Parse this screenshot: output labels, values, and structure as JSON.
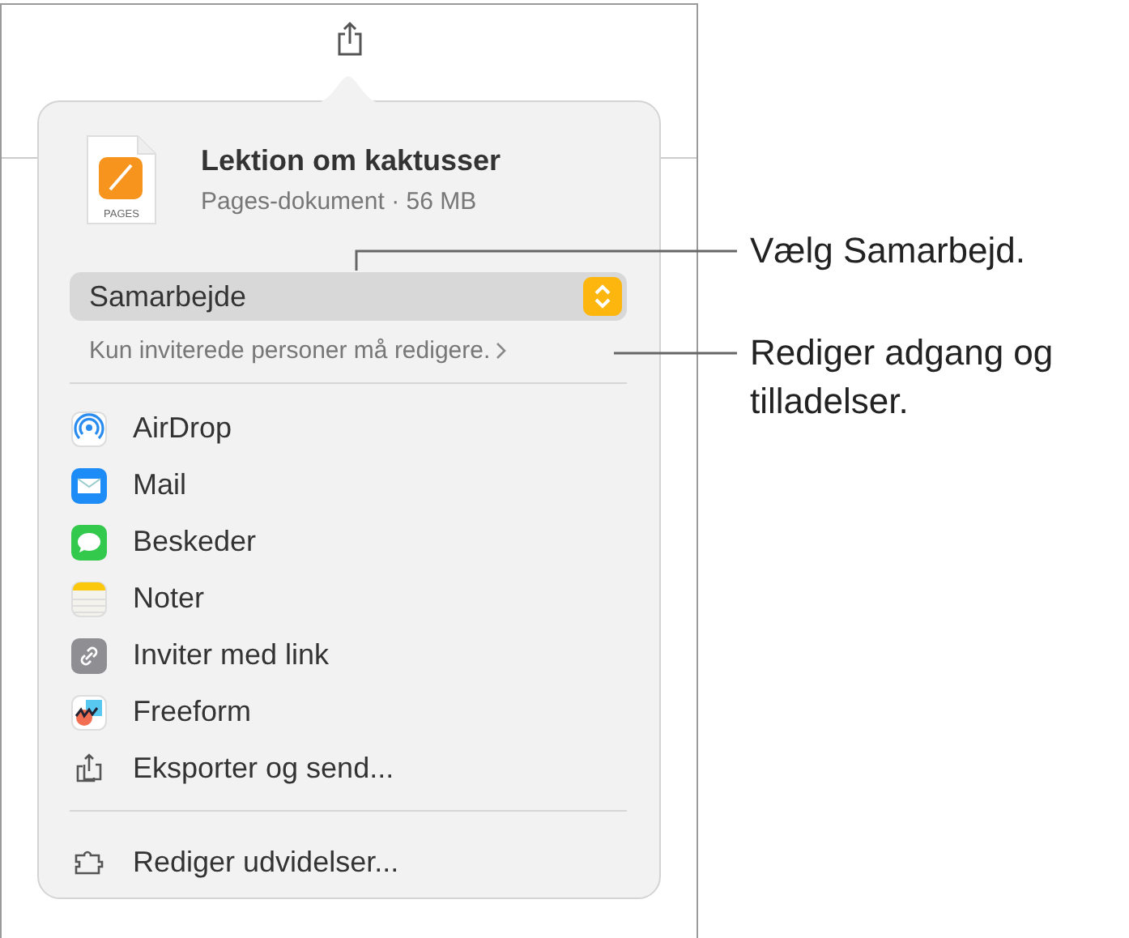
{
  "file": {
    "title": "Lektion om kaktusser",
    "subtitle": "Pages-dokument · 56 MB",
    "icon_label": "PAGES"
  },
  "mode_popup": {
    "value": "Samarbejde"
  },
  "access_link": "Kun inviterede personer må redigere.",
  "share_options": [
    {
      "kind": "airdrop",
      "label": "AirDrop"
    },
    {
      "kind": "mail",
      "label": "Mail"
    },
    {
      "kind": "messages",
      "label": "Beskeder"
    },
    {
      "kind": "notes",
      "label": "Noter"
    },
    {
      "kind": "link",
      "label": "Inviter med link"
    },
    {
      "kind": "freeform",
      "label": "Freeform"
    },
    {
      "kind": "export",
      "label": "Eksporter og send..."
    }
  ],
  "footer_item": {
    "kind": "extensions",
    "label": "Rediger udvidelser..."
  },
  "callouts": [
    {
      "text": "Vælg Samarbejd."
    },
    {
      "text": "Rediger adgang og tilladelser."
    }
  ]
}
